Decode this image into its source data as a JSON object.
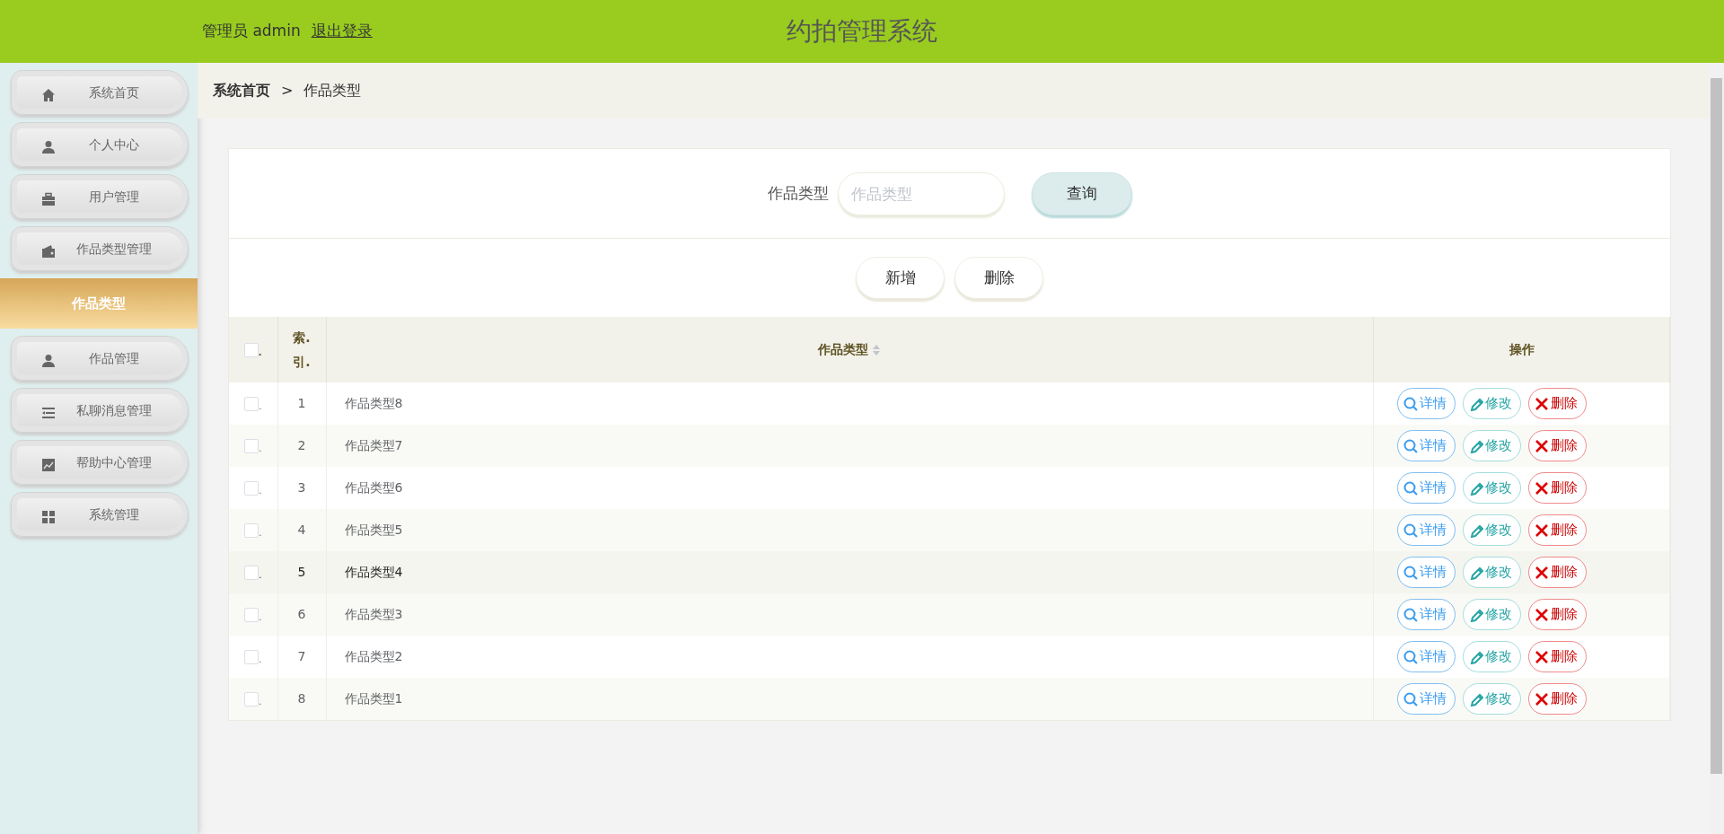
{
  "header": {
    "user": "管理员 admin",
    "logout": "退出登录",
    "title": "约拍管理系统"
  },
  "sidebar": {
    "items": [
      {
        "label": "系统首页",
        "kind": "menu",
        "selected": false
      },
      {
        "label": "个人中心",
        "kind": "menu",
        "selected": false
      },
      {
        "label": "用户管理",
        "kind": "menu",
        "selected": false
      },
      {
        "label": "作品类型管理",
        "kind": "menu",
        "selected": false
      },
      {
        "label": "作品类型",
        "kind": "submenu",
        "selected": true
      },
      {
        "label": "作品管理",
        "kind": "menu",
        "selected": false
      },
      {
        "label": "私聊消息管理",
        "kind": "menu",
        "selected": false
      },
      {
        "label": "帮助中心管理",
        "kind": "menu",
        "selected": false
      },
      {
        "label": "系统管理",
        "kind": "menu",
        "selected": false
      }
    ]
  },
  "breadcrumb": {
    "home": "系统首页",
    "separator": ">",
    "current": "作品类型"
  },
  "search": {
    "label": "作品类型",
    "placeholder": "作品类型",
    "button": "查询"
  },
  "actions": [
    "新增",
    "删除"
  ],
  "table": {
    "columns": [
      "索.引.",
      "作品类型",
      "操作"
    ],
    "header_checked": false,
    "header_checkbox_suffix": ".",
    "rows": [
      {
        "checkbox_suffix": ".",
        "index": "1",
        "type": "作品类型8",
        "checked": false,
        "hovered": false,
        "buttons": [
          {
            "label": "详情",
            "kind": "detail"
          },
          {
            "label": "修改",
            "kind": "edit"
          },
          {
            "label": "删除",
            "kind": "delete"
          }
        ]
      },
      {
        "checkbox_suffix": ".",
        "index": "2",
        "type": "作品类型7",
        "checked": false,
        "hovered": false,
        "buttons": [
          {
            "label": "详情",
            "kind": "detail"
          },
          {
            "label": "修改",
            "kind": "edit"
          },
          {
            "label": "删除",
            "kind": "delete"
          }
        ]
      },
      {
        "checkbox_suffix": ".",
        "index": "3",
        "type": "作品类型6",
        "checked": false,
        "hovered": false,
        "buttons": [
          {
            "label": "详情",
            "kind": "detail"
          },
          {
            "label": "修改",
            "kind": "edit"
          },
          {
            "label": "删除",
            "kind": "delete"
          }
        ]
      },
      {
        "checkbox_suffix": ".",
        "index": "4",
        "type": "作品类型5",
        "checked": false,
        "hovered": false,
        "buttons": [
          {
            "label": "详情",
            "kind": "detail"
          },
          {
            "label": "修改",
            "kind": "edit"
          },
          {
            "label": "删除",
            "kind": "delete"
          }
        ]
      },
      {
        "checkbox_suffix": ".",
        "index": "5",
        "type": "作品类型4",
        "checked": false,
        "hovered": true,
        "buttons": [
          {
            "label": "详情",
            "kind": "detail"
          },
          {
            "label": "修改",
            "kind": "edit"
          },
          {
            "label": "删除",
            "kind": "delete"
          }
        ]
      },
      {
        "checkbox_suffix": ".",
        "index": "6",
        "type": "作品类型3",
        "checked": false,
        "hovered": false,
        "buttons": [
          {
            "label": "详情",
            "kind": "detail"
          },
          {
            "label": "修改",
            "kind": "edit"
          },
          {
            "label": "删除",
            "kind": "delete"
          }
        ]
      },
      {
        "checkbox_suffix": ".",
        "index": "7",
        "type": "作品类型2",
        "checked": false,
        "hovered": false,
        "buttons": [
          {
            "label": "详情",
            "kind": "detail"
          },
          {
            "label": "修改",
            "kind": "edit"
          },
          {
            "label": "删除",
            "kind": "delete"
          }
        ]
      },
      {
        "checkbox_suffix": ".",
        "index": "8",
        "type": "作品类型1",
        "checked": false,
        "hovered": false,
        "buttons": [
          {
            "label": "详情",
            "kind": "detail"
          },
          {
            "label": "修改",
            "kind": "edit"
          },
          {
            "label": "删除",
            "kind": "delete"
          }
        ]
      }
    ]
  }
}
